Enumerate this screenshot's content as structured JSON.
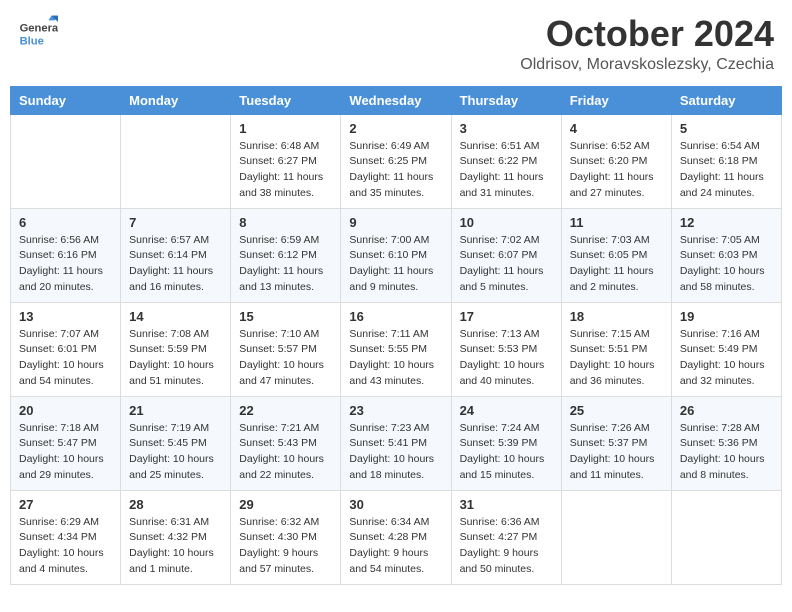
{
  "header": {
    "logo_general": "General",
    "logo_blue": "Blue",
    "month_title": "October 2024",
    "location": "Oldrisov, Moravskoslezsky, Czechia"
  },
  "weekdays": [
    "Sunday",
    "Monday",
    "Tuesday",
    "Wednesday",
    "Thursday",
    "Friday",
    "Saturday"
  ],
  "weeks": [
    [
      {
        "day": "",
        "sunrise": "",
        "sunset": "",
        "daylight": ""
      },
      {
        "day": "",
        "sunrise": "",
        "sunset": "",
        "daylight": ""
      },
      {
        "day": "1",
        "sunrise": "Sunrise: 6:48 AM",
        "sunset": "Sunset: 6:27 PM",
        "daylight": "Daylight: 11 hours and 38 minutes."
      },
      {
        "day": "2",
        "sunrise": "Sunrise: 6:49 AM",
        "sunset": "Sunset: 6:25 PM",
        "daylight": "Daylight: 11 hours and 35 minutes."
      },
      {
        "day": "3",
        "sunrise": "Sunrise: 6:51 AM",
        "sunset": "Sunset: 6:22 PM",
        "daylight": "Daylight: 11 hours and 31 minutes."
      },
      {
        "day": "4",
        "sunrise": "Sunrise: 6:52 AM",
        "sunset": "Sunset: 6:20 PM",
        "daylight": "Daylight: 11 hours and 27 minutes."
      },
      {
        "day": "5",
        "sunrise": "Sunrise: 6:54 AM",
        "sunset": "Sunset: 6:18 PM",
        "daylight": "Daylight: 11 hours and 24 minutes."
      }
    ],
    [
      {
        "day": "6",
        "sunrise": "Sunrise: 6:56 AM",
        "sunset": "Sunset: 6:16 PM",
        "daylight": "Daylight: 11 hours and 20 minutes."
      },
      {
        "day": "7",
        "sunrise": "Sunrise: 6:57 AM",
        "sunset": "Sunset: 6:14 PM",
        "daylight": "Daylight: 11 hours and 16 minutes."
      },
      {
        "day": "8",
        "sunrise": "Sunrise: 6:59 AM",
        "sunset": "Sunset: 6:12 PM",
        "daylight": "Daylight: 11 hours and 13 minutes."
      },
      {
        "day": "9",
        "sunrise": "Sunrise: 7:00 AM",
        "sunset": "Sunset: 6:10 PM",
        "daylight": "Daylight: 11 hours and 9 minutes."
      },
      {
        "day": "10",
        "sunrise": "Sunrise: 7:02 AM",
        "sunset": "Sunset: 6:07 PM",
        "daylight": "Daylight: 11 hours and 5 minutes."
      },
      {
        "day": "11",
        "sunrise": "Sunrise: 7:03 AM",
        "sunset": "Sunset: 6:05 PM",
        "daylight": "Daylight: 11 hours and 2 minutes."
      },
      {
        "day": "12",
        "sunrise": "Sunrise: 7:05 AM",
        "sunset": "Sunset: 6:03 PM",
        "daylight": "Daylight: 10 hours and 58 minutes."
      }
    ],
    [
      {
        "day": "13",
        "sunrise": "Sunrise: 7:07 AM",
        "sunset": "Sunset: 6:01 PM",
        "daylight": "Daylight: 10 hours and 54 minutes."
      },
      {
        "day": "14",
        "sunrise": "Sunrise: 7:08 AM",
        "sunset": "Sunset: 5:59 PM",
        "daylight": "Daylight: 10 hours and 51 minutes."
      },
      {
        "day": "15",
        "sunrise": "Sunrise: 7:10 AM",
        "sunset": "Sunset: 5:57 PM",
        "daylight": "Daylight: 10 hours and 47 minutes."
      },
      {
        "day": "16",
        "sunrise": "Sunrise: 7:11 AM",
        "sunset": "Sunset: 5:55 PM",
        "daylight": "Daylight: 10 hours and 43 minutes."
      },
      {
        "day": "17",
        "sunrise": "Sunrise: 7:13 AM",
        "sunset": "Sunset: 5:53 PM",
        "daylight": "Daylight: 10 hours and 40 minutes."
      },
      {
        "day": "18",
        "sunrise": "Sunrise: 7:15 AM",
        "sunset": "Sunset: 5:51 PM",
        "daylight": "Daylight: 10 hours and 36 minutes."
      },
      {
        "day": "19",
        "sunrise": "Sunrise: 7:16 AM",
        "sunset": "Sunset: 5:49 PM",
        "daylight": "Daylight: 10 hours and 32 minutes."
      }
    ],
    [
      {
        "day": "20",
        "sunrise": "Sunrise: 7:18 AM",
        "sunset": "Sunset: 5:47 PM",
        "daylight": "Daylight: 10 hours and 29 minutes."
      },
      {
        "day": "21",
        "sunrise": "Sunrise: 7:19 AM",
        "sunset": "Sunset: 5:45 PM",
        "daylight": "Daylight: 10 hours and 25 minutes."
      },
      {
        "day": "22",
        "sunrise": "Sunrise: 7:21 AM",
        "sunset": "Sunset: 5:43 PM",
        "daylight": "Daylight: 10 hours and 22 minutes."
      },
      {
        "day": "23",
        "sunrise": "Sunrise: 7:23 AM",
        "sunset": "Sunset: 5:41 PM",
        "daylight": "Daylight: 10 hours and 18 minutes."
      },
      {
        "day": "24",
        "sunrise": "Sunrise: 7:24 AM",
        "sunset": "Sunset: 5:39 PM",
        "daylight": "Daylight: 10 hours and 15 minutes."
      },
      {
        "day": "25",
        "sunrise": "Sunrise: 7:26 AM",
        "sunset": "Sunset: 5:37 PM",
        "daylight": "Daylight: 10 hours and 11 minutes."
      },
      {
        "day": "26",
        "sunrise": "Sunrise: 7:28 AM",
        "sunset": "Sunset: 5:36 PM",
        "daylight": "Daylight: 10 hours and 8 minutes."
      }
    ],
    [
      {
        "day": "27",
        "sunrise": "Sunrise: 6:29 AM",
        "sunset": "Sunset: 4:34 PM",
        "daylight": "Daylight: 10 hours and 4 minutes."
      },
      {
        "day": "28",
        "sunrise": "Sunrise: 6:31 AM",
        "sunset": "Sunset: 4:32 PM",
        "daylight": "Daylight: 10 hours and 1 minute."
      },
      {
        "day": "29",
        "sunrise": "Sunrise: 6:32 AM",
        "sunset": "Sunset: 4:30 PM",
        "daylight": "Daylight: 9 hours and 57 minutes."
      },
      {
        "day": "30",
        "sunrise": "Sunrise: 6:34 AM",
        "sunset": "Sunset: 4:28 PM",
        "daylight": "Daylight: 9 hours and 54 minutes."
      },
      {
        "day": "31",
        "sunrise": "Sunrise: 6:36 AM",
        "sunset": "Sunset: 4:27 PM",
        "daylight": "Daylight: 9 hours and 50 minutes."
      },
      {
        "day": "",
        "sunrise": "",
        "sunset": "",
        "daylight": ""
      },
      {
        "day": "",
        "sunrise": "",
        "sunset": "",
        "daylight": ""
      }
    ]
  ]
}
